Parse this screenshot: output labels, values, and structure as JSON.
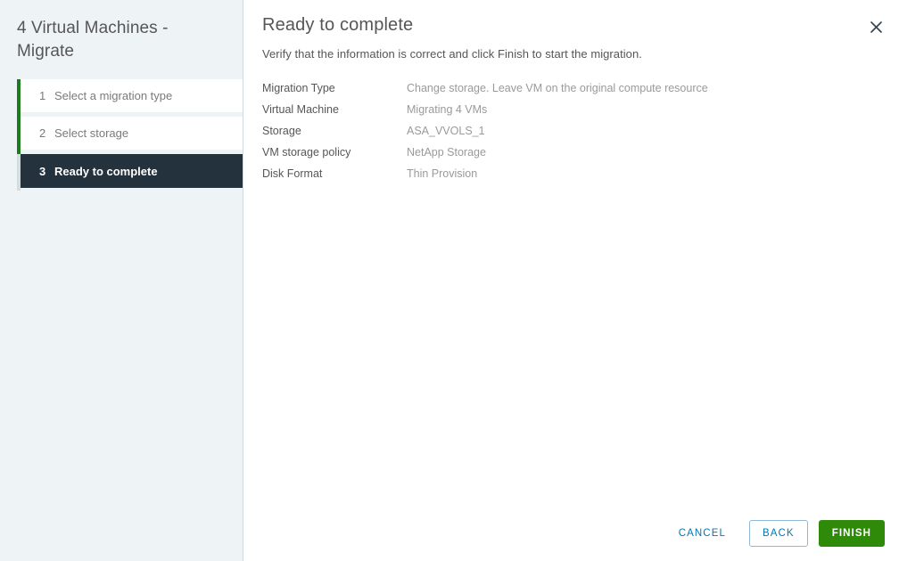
{
  "wizard": {
    "title": "4 Virtual Machines - Migrate",
    "close_icon": "close-icon"
  },
  "sidebar": {
    "steps": [
      {
        "number": "1",
        "label": "Select a migration type",
        "state": "complete"
      },
      {
        "number": "2",
        "label": "Select storage",
        "state": "complete"
      },
      {
        "number": "3",
        "label": "Ready to complete",
        "state": "active"
      }
    ]
  },
  "main": {
    "title": "Ready to complete",
    "subtitle": "Verify that the information is correct and click Finish to start the migration.",
    "summary": [
      {
        "label": "Migration Type",
        "value": "Change storage. Leave VM on the original compute resource"
      },
      {
        "label": "Virtual Machine",
        "value": "Migrating 4 VMs"
      },
      {
        "label": "Storage",
        "value": "ASA_VVOLS_1"
      },
      {
        "label": "VM storage policy",
        "value": "NetApp Storage"
      },
      {
        "label": "Disk Format",
        "value": "Thin Provision"
      }
    ]
  },
  "footer": {
    "cancel_label": "CANCEL",
    "back_label": "BACK",
    "finish_label": "FINISH"
  },
  "colors": {
    "sidebar_bg": "#eef3f6",
    "active_step_bg": "#23323c",
    "progress_green": "#1d7a1d",
    "primary_green": "#2f8a0a",
    "link_blue": "#0079b8",
    "outline_blue": "#8fb8d8",
    "label_gray": "#565656",
    "value_gray": "#9a9a9a"
  }
}
